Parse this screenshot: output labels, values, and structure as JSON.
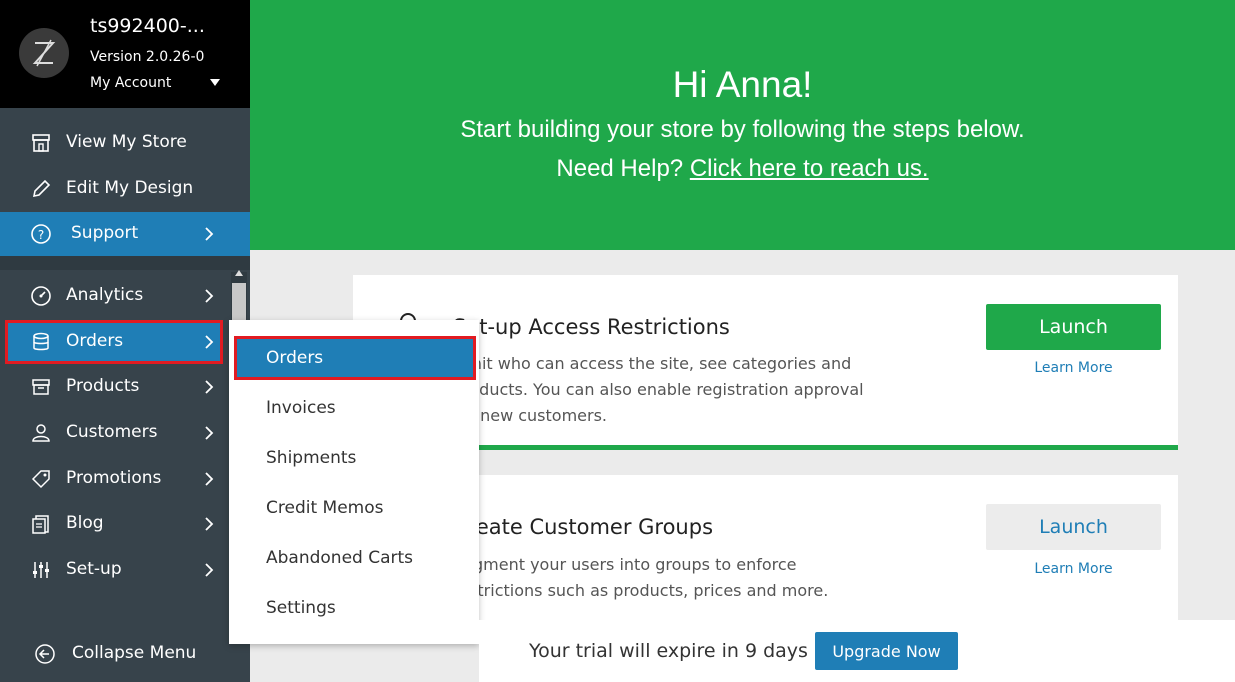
{
  "sidebar": {
    "store_name": "ts992400-...",
    "version": "Version 2.0.26-0",
    "my_account": "My Account",
    "top_items": [
      {
        "label": "View My Store",
        "icon": "storefront-icon"
      },
      {
        "label": "Edit My Design",
        "icon": "pencil-icon"
      },
      {
        "label": "Support",
        "icon": "help-circle-icon"
      }
    ],
    "items": [
      {
        "label": "Analytics",
        "icon": "speedometer-icon"
      },
      {
        "label": "Orders",
        "icon": "database-icon"
      },
      {
        "label": "Products",
        "icon": "box-icon"
      },
      {
        "label": "Customers",
        "icon": "user-icon"
      },
      {
        "label": "Promotions",
        "icon": "tag-icon"
      },
      {
        "label": "Blog",
        "icon": "document-icon"
      },
      {
        "label": "Set-up",
        "icon": "sliders-icon"
      }
    ],
    "collapse_label": "Collapse Menu"
  },
  "submenu": {
    "items": [
      "Orders",
      "Invoices",
      "Shipments",
      "Credit Memos",
      "Abandoned Carts",
      "Settings"
    ]
  },
  "hero": {
    "title": "Hi Anna!",
    "subtitle": "Start building your store by following the steps below.",
    "help_prefix": "Need Help?",
    "help_link": "Click here to reach us."
  },
  "cards": [
    {
      "title": "Set-up Access Restrictions",
      "desc": "Limit who can access the site, see categories and products. You can also enable registration approval for new customers.",
      "launch": "Launch",
      "learn_more": "Learn More"
    },
    {
      "title": "Create Customer Groups",
      "desc": "Segment your users into groups to enforce restrictions such as products, prices and more.",
      "launch": "Launch",
      "learn_more": "Learn More"
    }
  ],
  "trial": {
    "text": "Your trial will expire in 9 days",
    "upgrade": "Upgrade Now"
  },
  "colors": {
    "accent_green": "#1fa84a",
    "accent_blue": "#1f7eb6",
    "sidebar_bg": "#37434b",
    "highlight_red": "#e11b22"
  }
}
